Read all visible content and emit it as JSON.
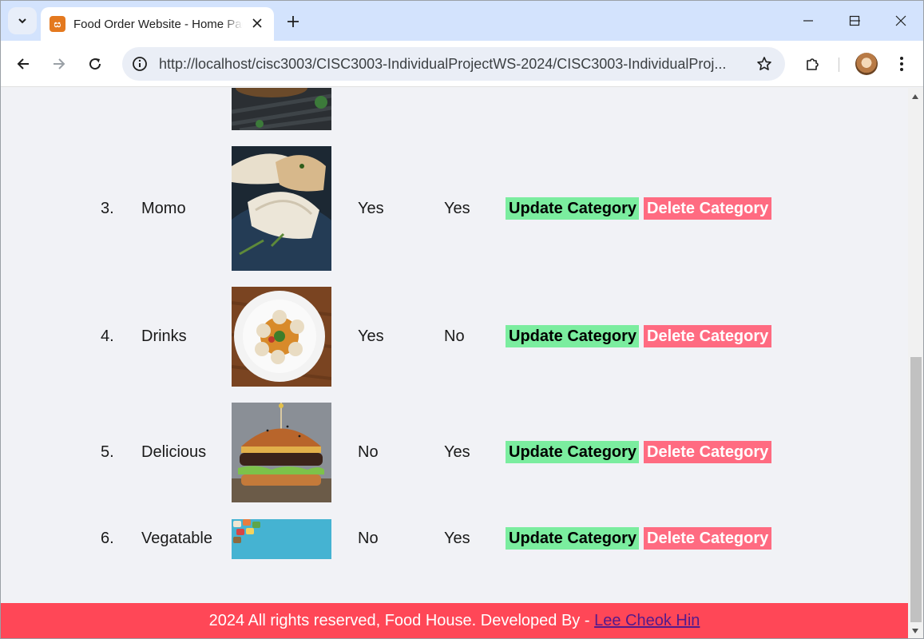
{
  "browser": {
    "tab_title": "Food Order Website - Home Page",
    "url": "http://localhost/cisc3003/CISC3003-IndividualProjectWS-2024/CISC3003-IndividualProj..."
  },
  "categories": [
    {
      "sn": "3.",
      "title": "Momo",
      "featured": "Yes",
      "active": "Yes"
    },
    {
      "sn": "4.",
      "title": "Drinks",
      "featured": "Yes",
      "active": "No"
    },
    {
      "sn": "5.",
      "title": "Delicious",
      "featured": "No",
      "active": "Yes"
    },
    {
      "sn": "6.",
      "title": "Vegatable",
      "featured": "No",
      "active": "Yes"
    }
  ],
  "actions": {
    "update_label": "Update Category",
    "delete_label": "Delete Category"
  },
  "footer": {
    "text": "2024 All rights reserved, Food House. Developed By - ",
    "link": "Lee Cheok Hin"
  },
  "colors": {
    "update_button": "#7bed9f",
    "delete_button": "#ff6b81",
    "footer": "#ff4757"
  }
}
